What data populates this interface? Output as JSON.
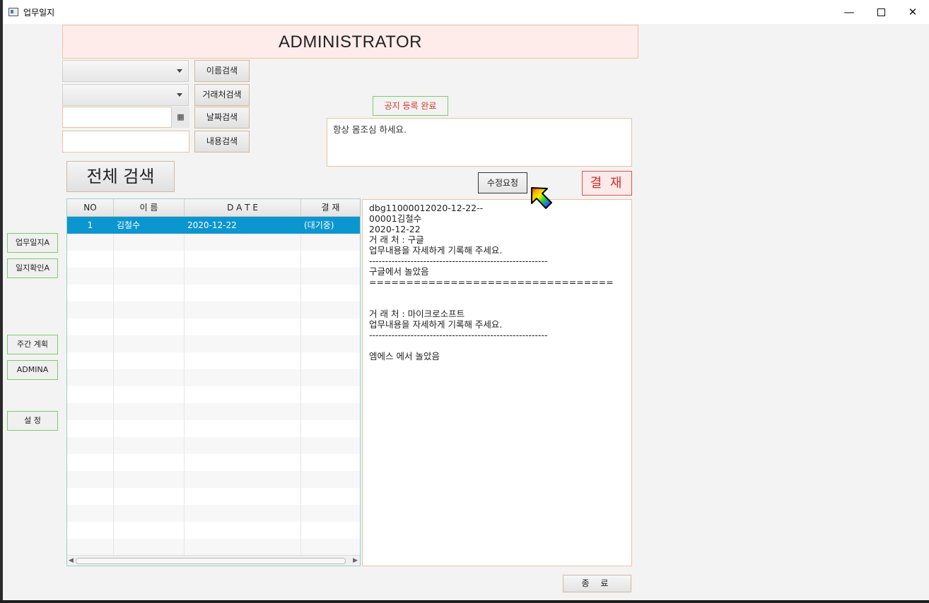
{
  "window": {
    "title": "업무일지",
    "minimize_glyph": "—",
    "close_glyph": "✕"
  },
  "header": {
    "title": "ADMINISTRATOR"
  },
  "search": {
    "name_combo_value": "",
    "client_combo_value": "",
    "date_value": "",
    "content_value": "",
    "name_search_label": "이름검색",
    "client_search_label": "거래처검색",
    "date_search_label": "날짜검색",
    "content_search_label": "내용검색",
    "all_search_label": "전체 검색",
    "calendar_glyph": "▦"
  },
  "notice": {
    "register_label": "공지 등록 완료",
    "text": "항상 몸조심 하세요."
  },
  "actions": {
    "fix_request_label": "수정요청",
    "approve_label": "결 재",
    "exit_label": "종 료"
  },
  "sidebar": {
    "items": [
      {
        "label": "업무일지A"
      },
      {
        "label": "일지확인A"
      },
      {
        "label": "주간 계획"
      },
      {
        "label": "ADMINA"
      },
      {
        "label": "설 정"
      }
    ]
  },
  "table": {
    "columns": [
      "NO",
      "이 름",
      "D A T E",
      "결 재"
    ],
    "rows": [
      [
        "1",
        "김철수",
        "2020-12-22",
        "(대기중)"
      ]
    ],
    "empty_rows": 19
  },
  "detail": {
    "lines": [
      "dbg11000012020-12-22--",
      "00001김철수",
      "2020-12-22",
      "거 래 처 : 구글",
      "업무내용을 자세하게 기록해 주세요.",
      "--------------------------------------------------------",
      "구글에서 놀았음",
      "=================================",
      "",
      "",
      "거 래 처 : 마이크로소프트",
      "업무내용을 자세하게 기록해 주세요.",
      "--------------------------------------------------------",
      "",
      "엠에스 에서 놀았음"
    ]
  },
  "colors": {
    "accent_selected": "#0c96d0",
    "approve_red": "#d82a2a",
    "green_border": "#7ecb6a"
  }
}
